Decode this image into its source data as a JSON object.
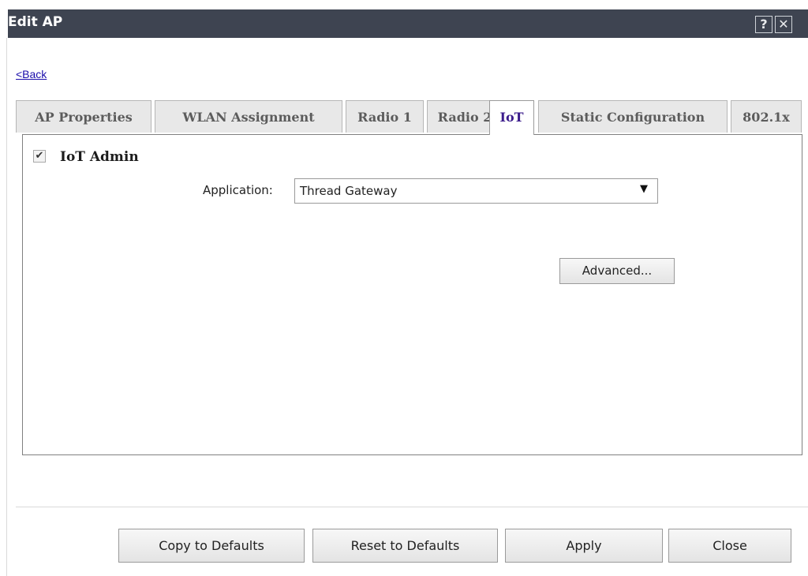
{
  "window": {
    "title": "Edit AP",
    "help_symbol": "?",
    "close_symbol": "✕"
  },
  "nav": {
    "back_label": "<Back"
  },
  "tabs": [
    {
      "label": "AP Properties",
      "active": false
    },
    {
      "label": "WLAN Assignment",
      "active": false
    },
    {
      "label": "Radio 1",
      "active": false
    },
    {
      "label": "Radio 2",
      "active": false
    },
    {
      "label": "IoT",
      "active": true
    },
    {
      "label": "Static Configuration",
      "active": false
    },
    {
      "label": "802.1x",
      "active": false
    }
  ],
  "iot": {
    "admin_label": "IoT Admin",
    "admin_checked": true,
    "application_label": "Application:",
    "application_value": "Thread Gateway",
    "advanced_label": "Advanced..."
  },
  "footer": {
    "copy_label": "Copy to Defaults",
    "reset_label": "Reset to Defaults",
    "apply_label": "Apply",
    "close_label": "Close"
  },
  "colors": {
    "titlebar": "#3e4451",
    "active_tab_text": "#3c1d8c",
    "link": "#1a0dab"
  },
  "icons": {
    "help": "help-icon",
    "close": "close-icon",
    "checkbox": "checkmark-icon",
    "dropdown": "triangle-down-icon"
  }
}
